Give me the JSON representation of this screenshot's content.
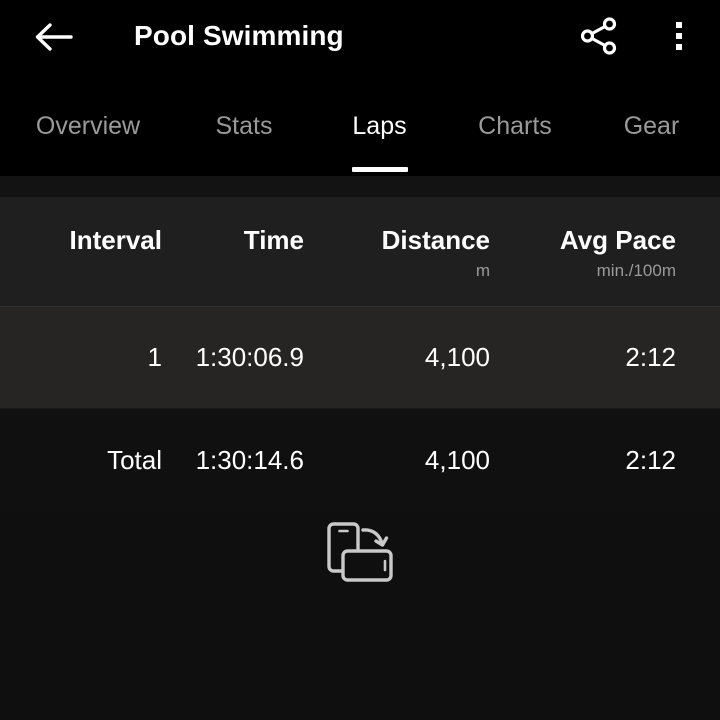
{
  "appbar": {
    "title": "Pool Swimming",
    "back_icon": "arrow-left-icon",
    "share_icon": "share-icon",
    "overflow_icon": "more-vertical-icon"
  },
  "tabs": [
    {
      "label": "Overview",
      "active": false
    },
    {
      "label": "Stats",
      "active": false
    },
    {
      "label": "Laps",
      "active": true
    },
    {
      "label": "Charts",
      "active": false
    },
    {
      "label": "Gear",
      "active": false
    }
  ],
  "laps_table": {
    "columns": [
      {
        "label": "Interval",
        "sub": ""
      },
      {
        "label": "Time",
        "sub": ""
      },
      {
        "label": "Distance",
        "sub": "m"
      },
      {
        "label": "Avg Pace",
        "sub": "min./100m"
      }
    ],
    "rows": [
      {
        "interval": "1",
        "time": "1:30:06.9",
        "distance": "4,100",
        "avg_pace": "2:12"
      }
    ],
    "total": {
      "interval": "Total",
      "time": "1:30:14.6",
      "distance": "4,100",
      "avg_pace": "2:12"
    }
  },
  "rotate_hint": {
    "icon": "rotate-device-icon"
  },
  "colors": {
    "background": "#0f0f0f",
    "appbar_background": "#000000",
    "header_background": "#1f1f1f",
    "row_highlight": "#272523",
    "text_primary": "#ffffff",
    "text_secondary": "#9a9a9a",
    "accent": "#ffffff"
  }
}
